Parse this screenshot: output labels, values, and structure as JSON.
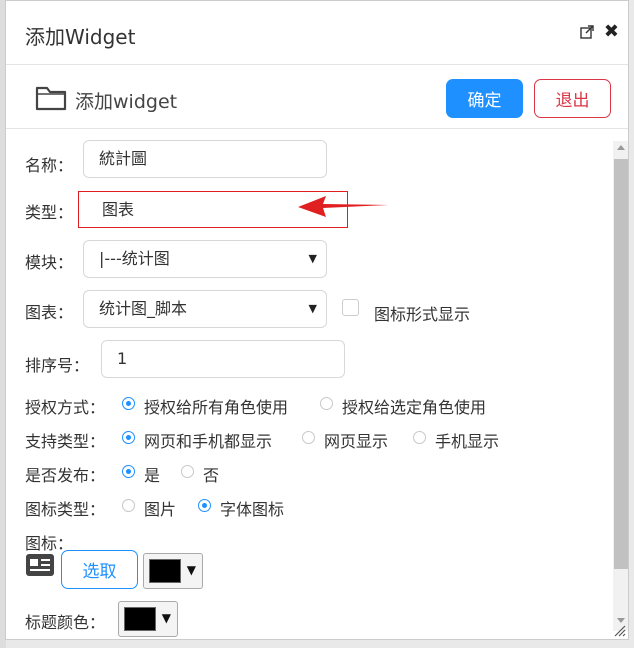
{
  "dialog": {
    "title": "添加Widget",
    "header_title": "添加widget",
    "ok_label": "确定",
    "exit_label": "退出"
  },
  "form": {
    "name": {
      "label": "名称：",
      "value": "統計圖"
    },
    "type": {
      "label": "类型：",
      "value": "图表"
    },
    "module": {
      "label": "模块：",
      "value": "|---统计图"
    },
    "chart": {
      "label": "图表：",
      "value": "统计图_脚本",
      "checkbox_label": "图标形式显示"
    },
    "order": {
      "label": "排序号：",
      "value": "1"
    },
    "auth": {
      "label": "授权方式：",
      "options": [
        "授权给所有角色使用",
        "授权给选定角色使用"
      ],
      "selected": 0
    },
    "support": {
      "label": "支持类型：",
      "options": [
        "网页和手机都显示",
        "网页显示",
        "手机显示"
      ],
      "selected": 0
    },
    "publish": {
      "label": "是否发布：",
      "options": [
        "是",
        "否"
      ],
      "selected": 0
    },
    "icon_type": {
      "label": "图标类型：",
      "options": [
        "图片",
        "字体图标"
      ],
      "selected": 1
    },
    "icon": {
      "label": "图标：",
      "choose_label": "选取",
      "color": "#000000"
    },
    "title_color": {
      "label": "标题颜色：",
      "color": "#000000"
    }
  },
  "colors": {
    "primary": "#1e90ff",
    "danger": "#dc3545",
    "highlight": "#e02020"
  },
  "icons": [
    "maximize-icon",
    "close-icon",
    "folder-icon",
    "id-card-icon",
    "red-arrow-icon"
  ]
}
